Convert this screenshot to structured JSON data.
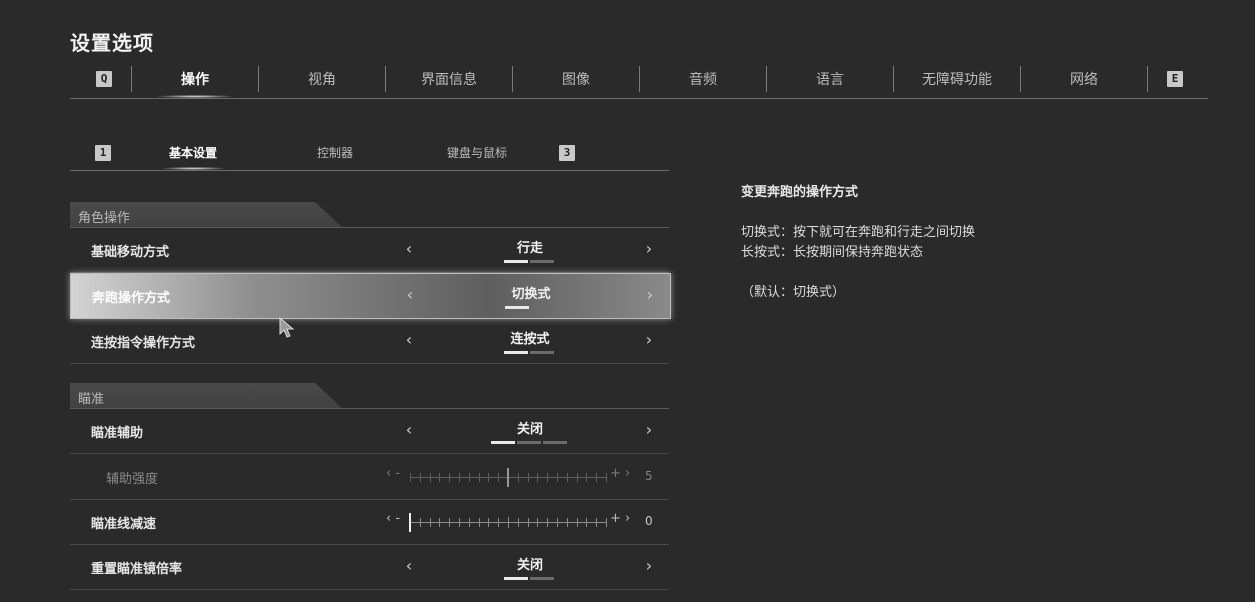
{
  "title": "设置选项",
  "tabs": {
    "key_left": "Q",
    "key_right": "E",
    "items": [
      "操作",
      "视角",
      "界面信息",
      "图像",
      "音频",
      "语言",
      "无障碍功能",
      "网络"
    ],
    "active_index": 0
  },
  "subtabs": {
    "key_left": "1",
    "key_right": "3",
    "items": [
      "基本设置",
      "控制器",
      "键盘与鼠标"
    ],
    "active_index": 0
  },
  "sections": [
    {
      "header": "角色操作",
      "rows": [
        {
          "label": "基础移动方式",
          "type": "select",
          "value": "行走",
          "pips": 2,
          "pip_on": 1
        },
        {
          "label": "奔跑操作方式",
          "type": "select",
          "value": "切换式",
          "pips": 2,
          "pip_on": 1,
          "selected": true
        },
        {
          "label": "连按指令操作方式",
          "type": "select",
          "value": "连按式",
          "pips": 2,
          "pip_on": 1
        }
      ]
    },
    {
      "header": "瞄准",
      "rows": [
        {
          "label": "瞄准辅助",
          "type": "select",
          "value": "关闭",
          "pips": 3,
          "pip_on": 1
        },
        {
          "label": "辅助强度",
          "type": "slider",
          "value": "5",
          "level": 0.5,
          "disabled": true
        },
        {
          "label": "瞄准线减速",
          "type": "slider",
          "value": "0",
          "level": 0.0
        },
        {
          "label": "重置瞄准镜倍率",
          "type": "select",
          "value": "关闭",
          "pips": 2,
          "pip_on": 1
        }
      ]
    }
  ],
  "description": {
    "heading": "变更奔跑的操作方式",
    "lines": [
      "切换式：按下就可在奔跑和行走之间切换",
      "长按式：长按期间保持奔跑状态"
    ],
    "default_note": "（默认：切换式）"
  },
  "icons": {
    "left": "chevron-left-icon",
    "right": "chevron-right-icon",
    "cursor": "mouse-cursor-icon"
  },
  "colors": {
    "background": "#2a2a2a",
    "text": "#dcdcdc",
    "accent": "#ffffff"
  }
}
